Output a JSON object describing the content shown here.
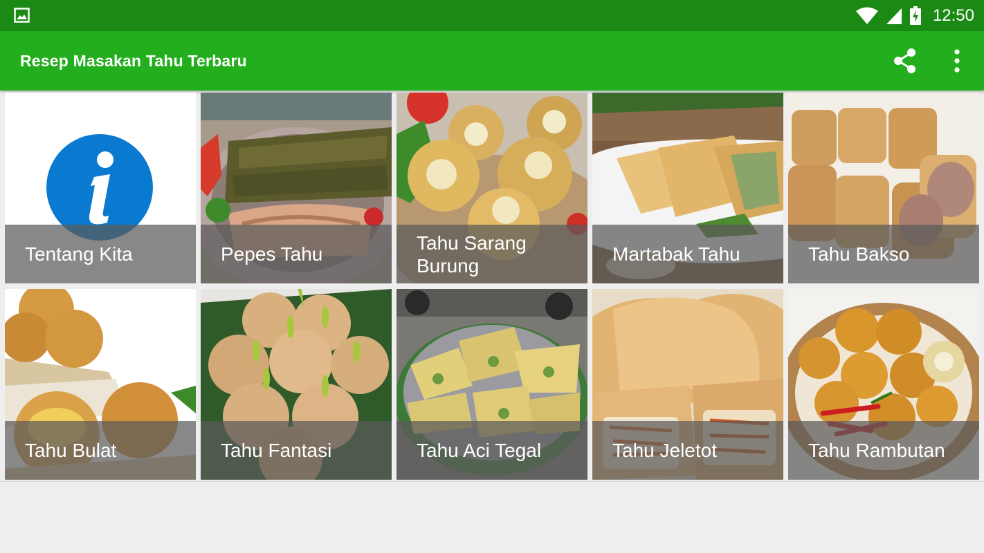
{
  "status_bar": {
    "time": "12:50",
    "icons": [
      "image-notification-icon",
      "wifi-icon",
      "cell-signal-icon",
      "battery-charging-icon"
    ]
  },
  "app_bar": {
    "title": "Resep Masakan Tahu Terbaru",
    "actions": [
      "share-icon",
      "more-vert-icon"
    ],
    "color": "#23af1d",
    "status_color": "#1a8a14"
  },
  "grid": {
    "items": [
      {
        "label": "Tentang Kita",
        "icon": "info-icon"
      },
      {
        "label": "Pepes Tahu"
      },
      {
        "label": "Tahu Sarang Burung"
      },
      {
        "label": "Martabak Tahu"
      },
      {
        "label": "Tahu Bakso"
      },
      {
        "label": "Tahu Bulat"
      },
      {
        "label": "Tahu Fantasi"
      },
      {
        "label": "Tahu Aci Tegal"
      },
      {
        "label": "Tahu Jeletot"
      },
      {
        "label": "Tahu Rambutan"
      }
    ]
  }
}
